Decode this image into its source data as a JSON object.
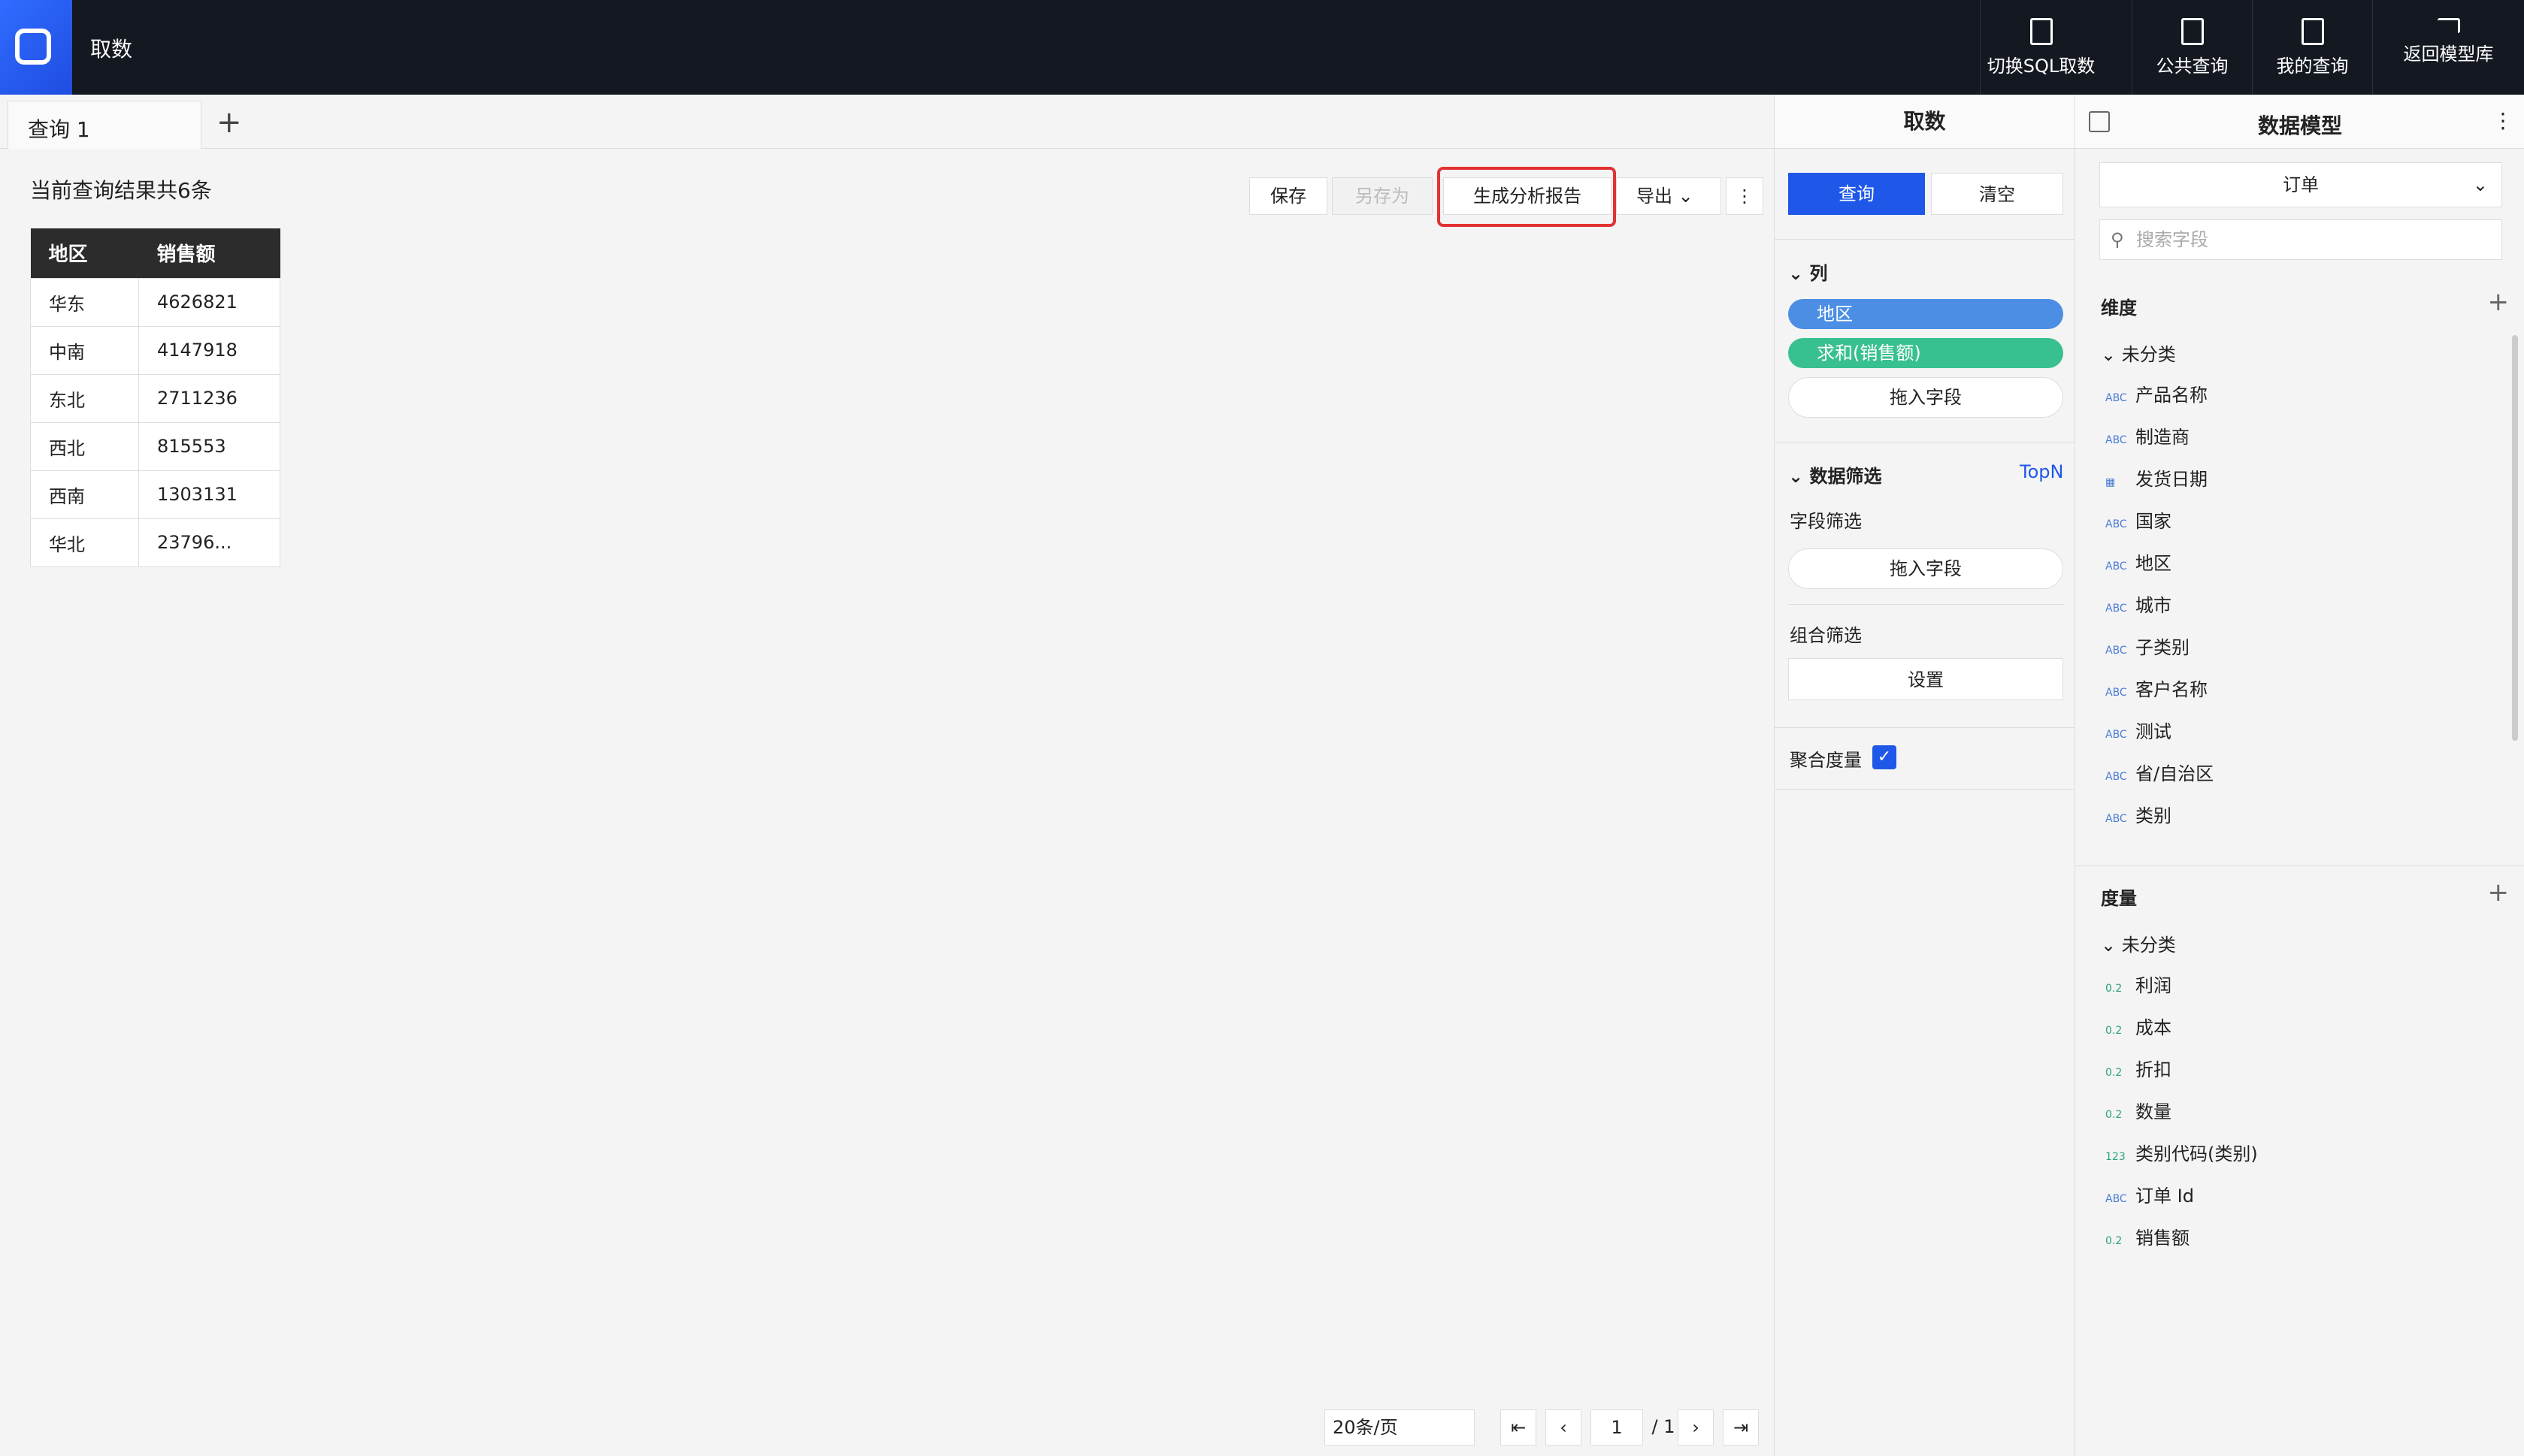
{
  "app": {
    "title": "取数"
  },
  "toolbar": {
    "switch_sql": "切换SQL取数",
    "public_query": "公共查询",
    "my_query": "我的查询",
    "back_model": "返回模型库"
  },
  "tabs": {
    "active": "查询 1",
    "add": "+"
  },
  "result": {
    "summary": "当前查询结果共6条",
    "save": "保存",
    "save_as": "另存为",
    "generate_report": "生成分析报告",
    "export": "导出"
  },
  "table": {
    "headers": [
      "地区",
      "销售额"
    ],
    "rows": [
      [
        "华东",
        "4626821"
      ],
      [
        "中南",
        "4147918"
      ],
      [
        "东北",
        "2711236"
      ],
      [
        "西北",
        "815553"
      ],
      [
        "西南",
        "1303131"
      ],
      [
        "华北",
        "23796..."
      ]
    ]
  },
  "pager": {
    "page_size": "20条/页",
    "current": "1",
    "total": "/ 1"
  },
  "middle": {
    "title": "取数",
    "query": "查询",
    "clear": "清空",
    "columns_label": "列",
    "col1": "地区",
    "col2": "求和(销售额)",
    "drag1": "拖入字段",
    "filter_label": "数据筛选",
    "topn": "TopN",
    "field_filter": "字段筛选",
    "drag2": "拖入字段",
    "combo_filter": "组合筛选",
    "set": "设置",
    "aggregate": "聚合度量"
  },
  "model": {
    "title": "数据模型",
    "selected": "订单",
    "search_placeholder": "搜索字段",
    "dimension": "维度",
    "uncategorized": "未分类",
    "dims": [
      "产品名称",
      "制造商",
      "发货日期",
      "国家",
      "地区",
      "城市",
      "子类别",
      "客户名称",
      "测试",
      "省/自治区",
      "类别"
    ],
    "measure": "度量",
    "measure_uncategorized": "未分类",
    "measures": [
      "利润",
      "成本",
      "折扣",
      "数量",
      "类别代码(类别)",
      "订单 Id",
      "销售额"
    ]
  }
}
